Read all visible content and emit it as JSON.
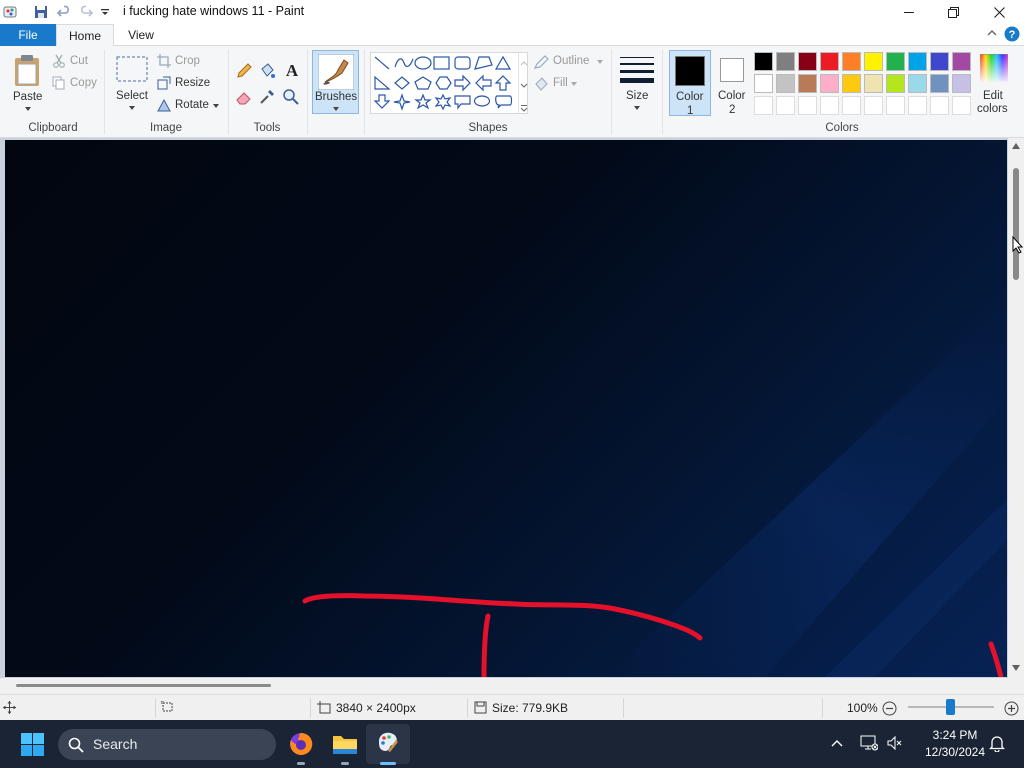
{
  "window": {
    "title": "i fucking hate windows 11 - Paint",
    "minimize_label": "—",
    "maximize_label": "▢",
    "close_label": "✕"
  },
  "tabs": {
    "file": "File",
    "home": "Home",
    "view": "View"
  },
  "ribbon": {
    "clipboard": {
      "paste": "Paste",
      "cut": "Cut",
      "copy": "Copy",
      "label": "Clipboard"
    },
    "image": {
      "select": "Select",
      "crop": "Crop",
      "resize": "Resize",
      "rotate": "Rotate",
      "label": "Image"
    },
    "tools": {
      "label": "Tools"
    },
    "brushes": {
      "label": "Brushes"
    },
    "shapes": {
      "outline": "Outline",
      "fill": "Fill",
      "label": "Shapes"
    },
    "size": {
      "label": "Size"
    },
    "color1": {
      "line1": "Color",
      "line2": "1",
      "value": "#000000"
    },
    "color2": {
      "line1": "Color",
      "line2": "2",
      "value": "#ffffff"
    },
    "colors": {
      "label": "Colors",
      "edit_line1": "Edit",
      "edit_line2": "colors",
      "row1": [
        "#000000",
        "#7f7f7f",
        "#880015",
        "#ed1c24",
        "#ff7f27",
        "#fff200",
        "#22b14c",
        "#00a2e8",
        "#3f48cc",
        "#a349a4"
      ],
      "row2": [
        "#ffffff",
        "#c3c3c3",
        "#b97a57",
        "#ffaec9",
        "#ffc90e",
        "#efe4b0",
        "#b5e61d",
        "#99d9ea",
        "#7092be",
        "#c8bfe7"
      ]
    }
  },
  "status": {
    "dimensions": "3840 × 2400px",
    "size": "Size: 779.9KB",
    "zoom": "100%"
  },
  "taskbar": {
    "search": "Search",
    "time": "3:24 PM",
    "date": "12/30/2024"
  }
}
